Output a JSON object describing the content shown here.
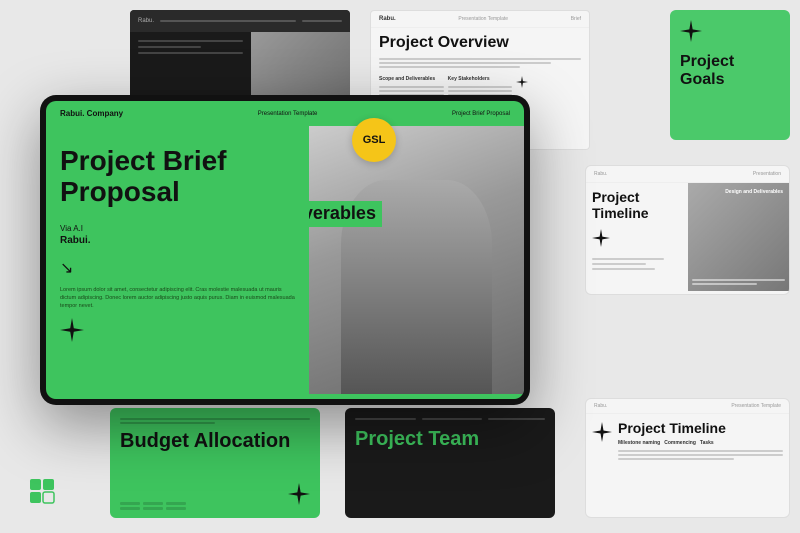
{
  "app": {
    "title": "Project Brief Proposal Template"
  },
  "gsl_badge": "GSL",
  "slides": {
    "dark_topleft": {
      "label": "Dark presentation slide"
    },
    "overview": {
      "title": "Project Overview",
      "brand": "Rabu.",
      "meta": "Presentation Template"
    },
    "goals": {
      "title": "Project Goals"
    },
    "main_tablet": {
      "brand": "Rabui. Company",
      "center": "Presentation Template",
      "right": "Project Brief Proposal",
      "title": "Project Brief Proposal",
      "subtitle_label": "Via A.I",
      "brand_name": "Rabui.",
      "body_text": "Lorem ipsum dolor sit amet, consectetur adipiscing elit. Cras molestie malesuada ut mauris dictum adipiscing. Donec lorem auctor adipiscing justo aquis purus. Diam in euismod malesuada tempor nevet."
    },
    "deliverables": {
      "text": "Deliverables"
    },
    "budget": {
      "title": "Budget Allocation"
    },
    "team": {
      "title": "Project Team"
    },
    "timeline_right": {
      "title": "Project Timeline"
    },
    "timeline_br": {
      "title": "Project Timeline"
    }
  },
  "icons": {
    "star": "✦",
    "arrow": "↘",
    "app": "app-icon"
  },
  "colors": {
    "green": "#3ec45e",
    "dark": "#1a1a1a",
    "light_bg": "#f5f5f5",
    "badge_yellow": "#f5c518"
  }
}
